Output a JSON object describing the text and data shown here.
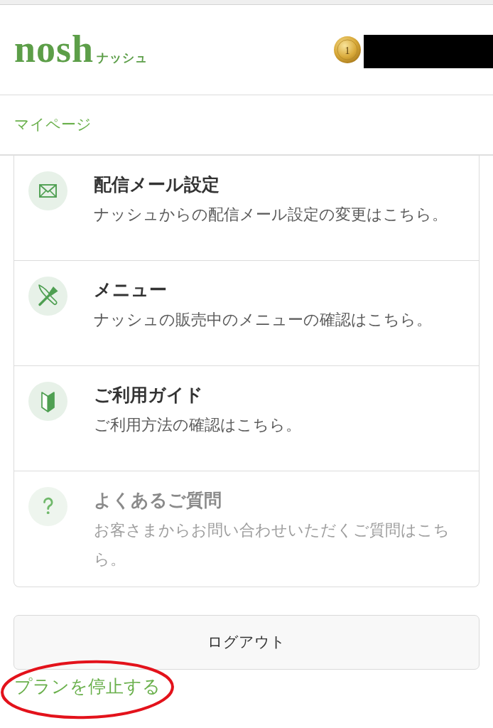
{
  "header": {
    "logo": {
      "wordmark": "nosh",
      "kana": "ナッシュ"
    },
    "rank_badge": {
      "rank": "1"
    },
    "user_name": {
      "redacted": true
    }
  },
  "breadcrumb": {
    "label": "マイページ"
  },
  "menu": [
    {
      "kind": "mail",
      "title": "配信メール設定",
      "description": "ナッシュからの配信メール設定の変更はこちら。",
      "disabled": false
    },
    {
      "kind": "menu",
      "title": "メニュー",
      "description": "ナッシュの販売中のメニューの確認はこちら。",
      "disabled": false
    },
    {
      "kind": "guide",
      "title": "ご利用ガイド",
      "description": "ご利用方法の確認はこちら。",
      "disabled": false
    },
    {
      "kind": "faq",
      "title": "よくあるご質問",
      "description": "お客さまからお問い合わせいただくご質問はこちら。",
      "disabled": true
    }
  ],
  "logout_button": {
    "label": "ログアウト"
  },
  "stop_plan_link": {
    "label": "プランを停止する",
    "circled": true
  }
}
